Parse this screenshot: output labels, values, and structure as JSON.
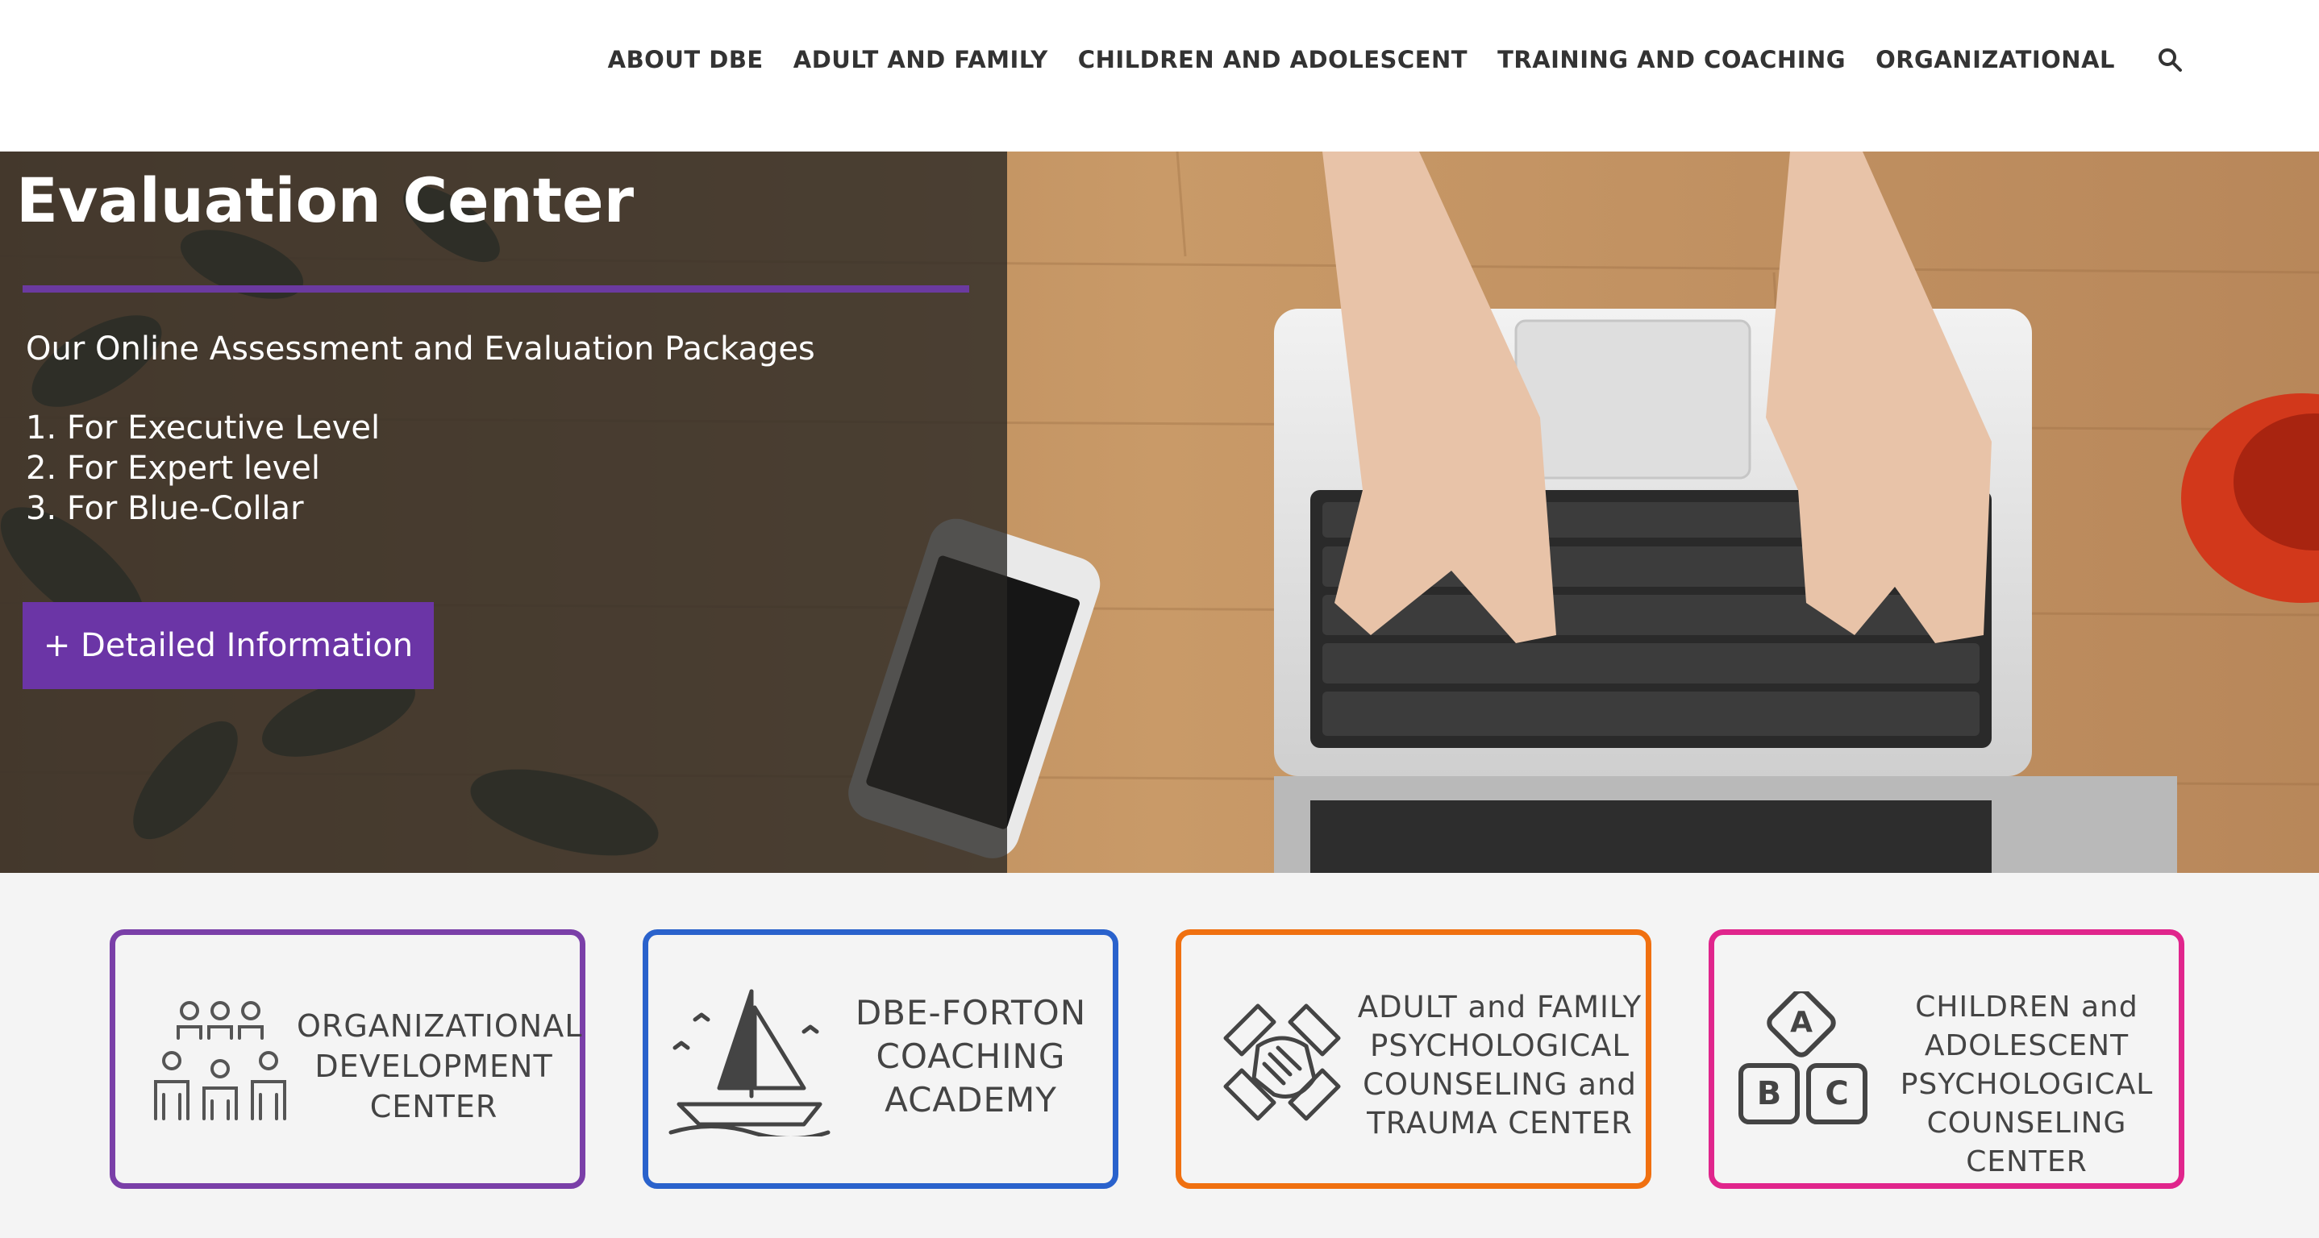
{
  "nav": {
    "items": [
      "ABOUT DBE",
      "ADULT AND FAMILY",
      "CHILDREN AND ADOLESCENT",
      "TRAINING AND COACHING",
      "ORGANIZATIONAL"
    ],
    "search_icon": "search-icon"
  },
  "hero": {
    "title": "Evaluation Center",
    "subtitle": "Our Online Assessment and Evaluation Packages",
    "list": [
      "1. For Executive Level",
      "2. For Expert level",
      "3. For Blue-Collar"
    ],
    "button_label": "+ Detailed Information",
    "accent_color": "#6b35a6"
  },
  "cards": [
    {
      "lines": [
        "ORGANIZATIONAL",
        "DEVELOPMENT",
        "CENTER"
      ],
      "border_color": "#7a3fa8",
      "icon": "team-icon"
    },
    {
      "lines": [
        "DBE-FORTON",
        "COACHING",
        "ACADEMY"
      ],
      "border_color": "#2a62cc",
      "icon": "sailboat-icon"
    },
    {
      "lines": [
        "ADULT and FAMILY",
        "PSYCHOLOGICAL",
        "COUNSELING and",
        "TRAUMA CENTER"
      ],
      "border_color": "#f07010",
      "icon": "joined-hands-icon"
    },
    {
      "lines": [
        "CHILDREN and",
        "ADOLESCENT",
        "PSYCHOLOGICAL",
        "COUNSELING CENTER"
      ],
      "border_color": "#e0258c",
      "icon": "abc-blocks-icon"
    }
  ]
}
